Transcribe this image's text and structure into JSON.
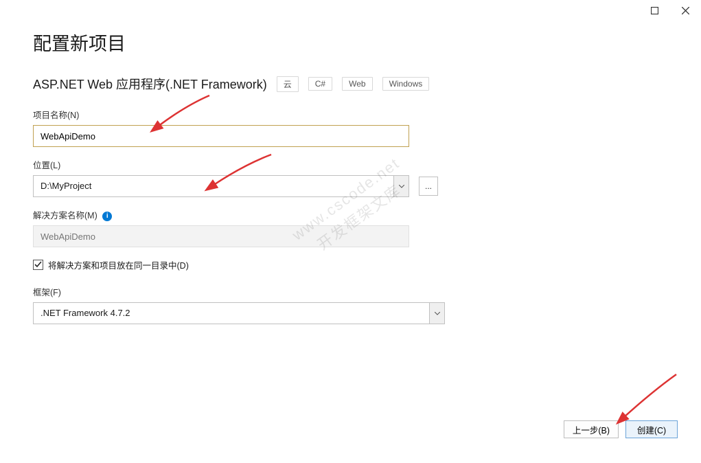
{
  "window": {
    "title": "配置新项目"
  },
  "project": {
    "template_name": "ASP.NET Web 应用程序(.NET Framework)",
    "tags": [
      "云",
      "C#",
      "Web",
      "Windows"
    ]
  },
  "fields": {
    "project_name": {
      "label": "项目名称(N)",
      "value": "WebApiDemo"
    },
    "location": {
      "label": "位置(L)",
      "value": "D:\\MyProject"
    },
    "solution_name": {
      "label": "解决方案名称(M)",
      "placeholder": "WebApiDemo"
    },
    "same_dir_checkbox": {
      "label": "将解决方案和项目放在同一目录中(D)",
      "checked": true
    },
    "framework": {
      "label": "框架(F)",
      "value": ".NET Framework 4.7.2"
    }
  },
  "buttons": {
    "browse": "...",
    "back": "上一步(B)",
    "create": "创建(C)"
  },
  "watermark": "www.cscode.net\n开发框架文库"
}
